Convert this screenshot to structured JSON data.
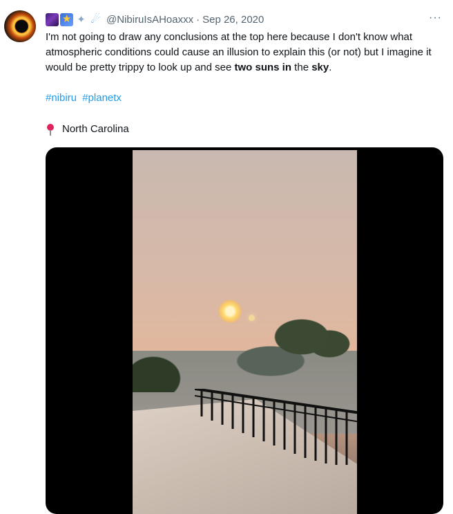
{
  "tweet": {
    "handle": "@NibiruIsAHoaxxx",
    "separator": "·",
    "date": "Sep 26, 2020",
    "more": "···",
    "text_before": "I'm not going to draw any conclusions at the top here because I don't know what atmospheric conditions could cause an illusion to explain this (or not) but I imagine it would be pretty trippy to look up and see ",
    "text_bold": "two suns in",
    "text_middle": " the ",
    "text_bold2": "sky",
    "text_after": ".",
    "hashtags": [
      "#nibiru",
      "#planetx"
    ],
    "location": "North Carolina"
  },
  "icons": {
    "name_emojis": [
      "milky-way-icon",
      "shooting-star-icon",
      "satellite-icon",
      "comet-icon"
    ],
    "location": "round-pushpin-icon"
  },
  "colors": {
    "link": "#1d9bf0",
    "muted": "#536471",
    "text": "#0f1419"
  }
}
